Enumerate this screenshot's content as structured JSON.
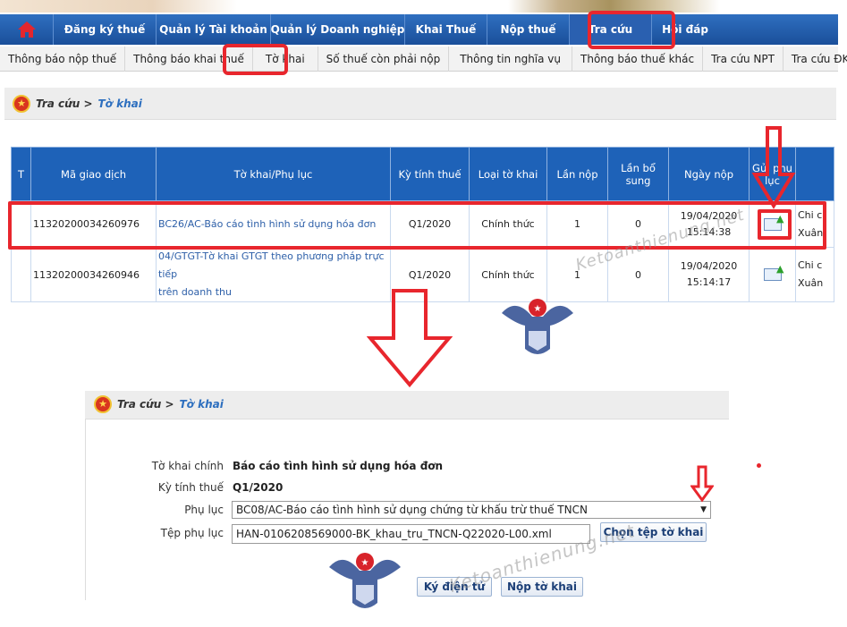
{
  "nav": {
    "items": [
      "Đăng ký thuế",
      "Quản lý Tài khoản",
      "Quản lý Doanh nghiệp",
      "Khai Thuế",
      "Nộp thuế",
      "Tra cứu",
      "Hỏi đáp"
    ]
  },
  "subnav": {
    "items": [
      "Thông báo nộp thuế",
      "Thông báo khai thuế",
      "Tờ khai",
      "Số thuế còn phải nộp",
      "Thông tin nghĩa vụ",
      "Thông báo thuế khác",
      "Tra cứu NPT",
      "Tra cứu ĐKT"
    ]
  },
  "breadcrumb": {
    "parent": "Tra cứu >",
    "current": "Tờ khai"
  },
  "table": {
    "headers": [
      "T",
      "Mã giao dịch",
      "Tờ khai/Phụ lục",
      "Kỳ tính thuế",
      "Loại tờ khai",
      "Lần nộp",
      "Lần bổ sung",
      "Ngày nộp",
      "Gửi phụ lục",
      ""
    ],
    "rows": [
      {
        "code": "11320200034260976",
        "form_line1": "BC26/AC-Báo cáo tình hình sử dụng hóa đơn",
        "form_line2": "",
        "period": "Q1/2020",
        "type": "Chính thức",
        "submit_count": "1",
        "supplement_count": "0",
        "date": "19/04/2020",
        "time": "15:14:38",
        "last_line1": "Chi c",
        "last_line2": "Xuân"
      },
      {
        "code": "11320200034260946",
        "form_line1": "04/GTGT-Tờ khai GTGT theo phương pháp trực tiếp",
        "form_line2": "trên doanh thu",
        "period": "Q1/2020",
        "type": "Chính thức",
        "submit_count": "1",
        "supplement_count": "0",
        "date": "19/04/2020",
        "time": "15:14:17",
        "last_line1": "Chi c",
        "last_line2": "Xuân"
      }
    ]
  },
  "watermark": "Ketoanthienung.net",
  "form": {
    "breadcrumb_parent": "Tra cứu >",
    "breadcrumb_current": "Tờ khai",
    "labels": {
      "declaration": "Tờ khai chính",
      "period": "Kỳ tính thuế",
      "appendix": "Phụ lục",
      "appendix_file": "Tệp phụ lục"
    },
    "values": {
      "declaration": "Báo cáo tình hình sử dụng hóa đơn",
      "period": "Q1/2020",
      "appendix_selected": "BC08/AC-Báo cáo tình hình sử dụng chứng từ khấu trừ thuế TNCN",
      "appendix_file": "HAN-0106208569000-BK_khau_tru_TNCN-Q22020-L00.xml"
    },
    "buttons": {
      "choose_file": "Chọn tệp tờ khai",
      "sign": "Ký điện tử",
      "submit": "Nộp tờ khai"
    }
  },
  "colors": {
    "nav_bg": "#1a4f9a",
    "table_header_bg": "#1e62b8",
    "highlight_red": "#e8262d",
    "link_blue": "#2d5fa8"
  }
}
